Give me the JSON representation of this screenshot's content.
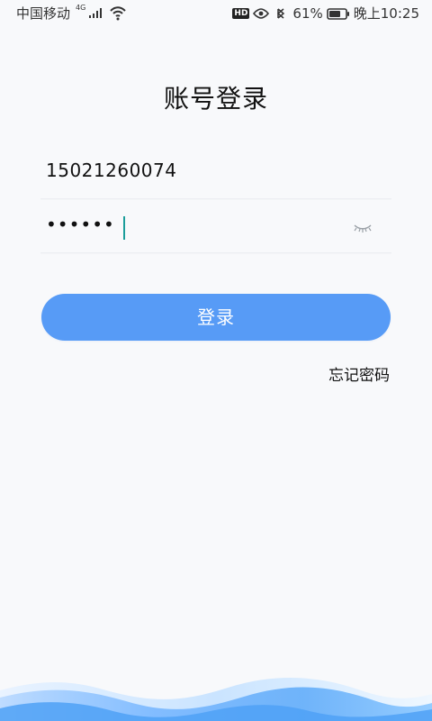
{
  "status_bar": {
    "carrier": "中国移动",
    "network_type": "4G",
    "battery_percent": "61%",
    "time": "晚上10:25",
    "icons": {
      "signal": "signal-icon",
      "wifi": "wifi-icon",
      "hd": "hd-icon",
      "eye": "eye-icon",
      "bluetooth": "bluetooth-icon",
      "battery": "battery-icon"
    }
  },
  "login": {
    "title": "账号登录",
    "account_value": "15021260074",
    "password_value": "••••••",
    "password_toggle_icon": "eye-closed-icon",
    "button_label": "登录",
    "forgot_password_label": "忘记密码"
  },
  "colors": {
    "background": "#f8f9fb",
    "primary_button": "#579bf6",
    "cursor": "#1b9d9a",
    "wave_light": "#dbeaff",
    "wave_mid": "#8fc1ff",
    "wave_dark": "#4f9ef7"
  }
}
